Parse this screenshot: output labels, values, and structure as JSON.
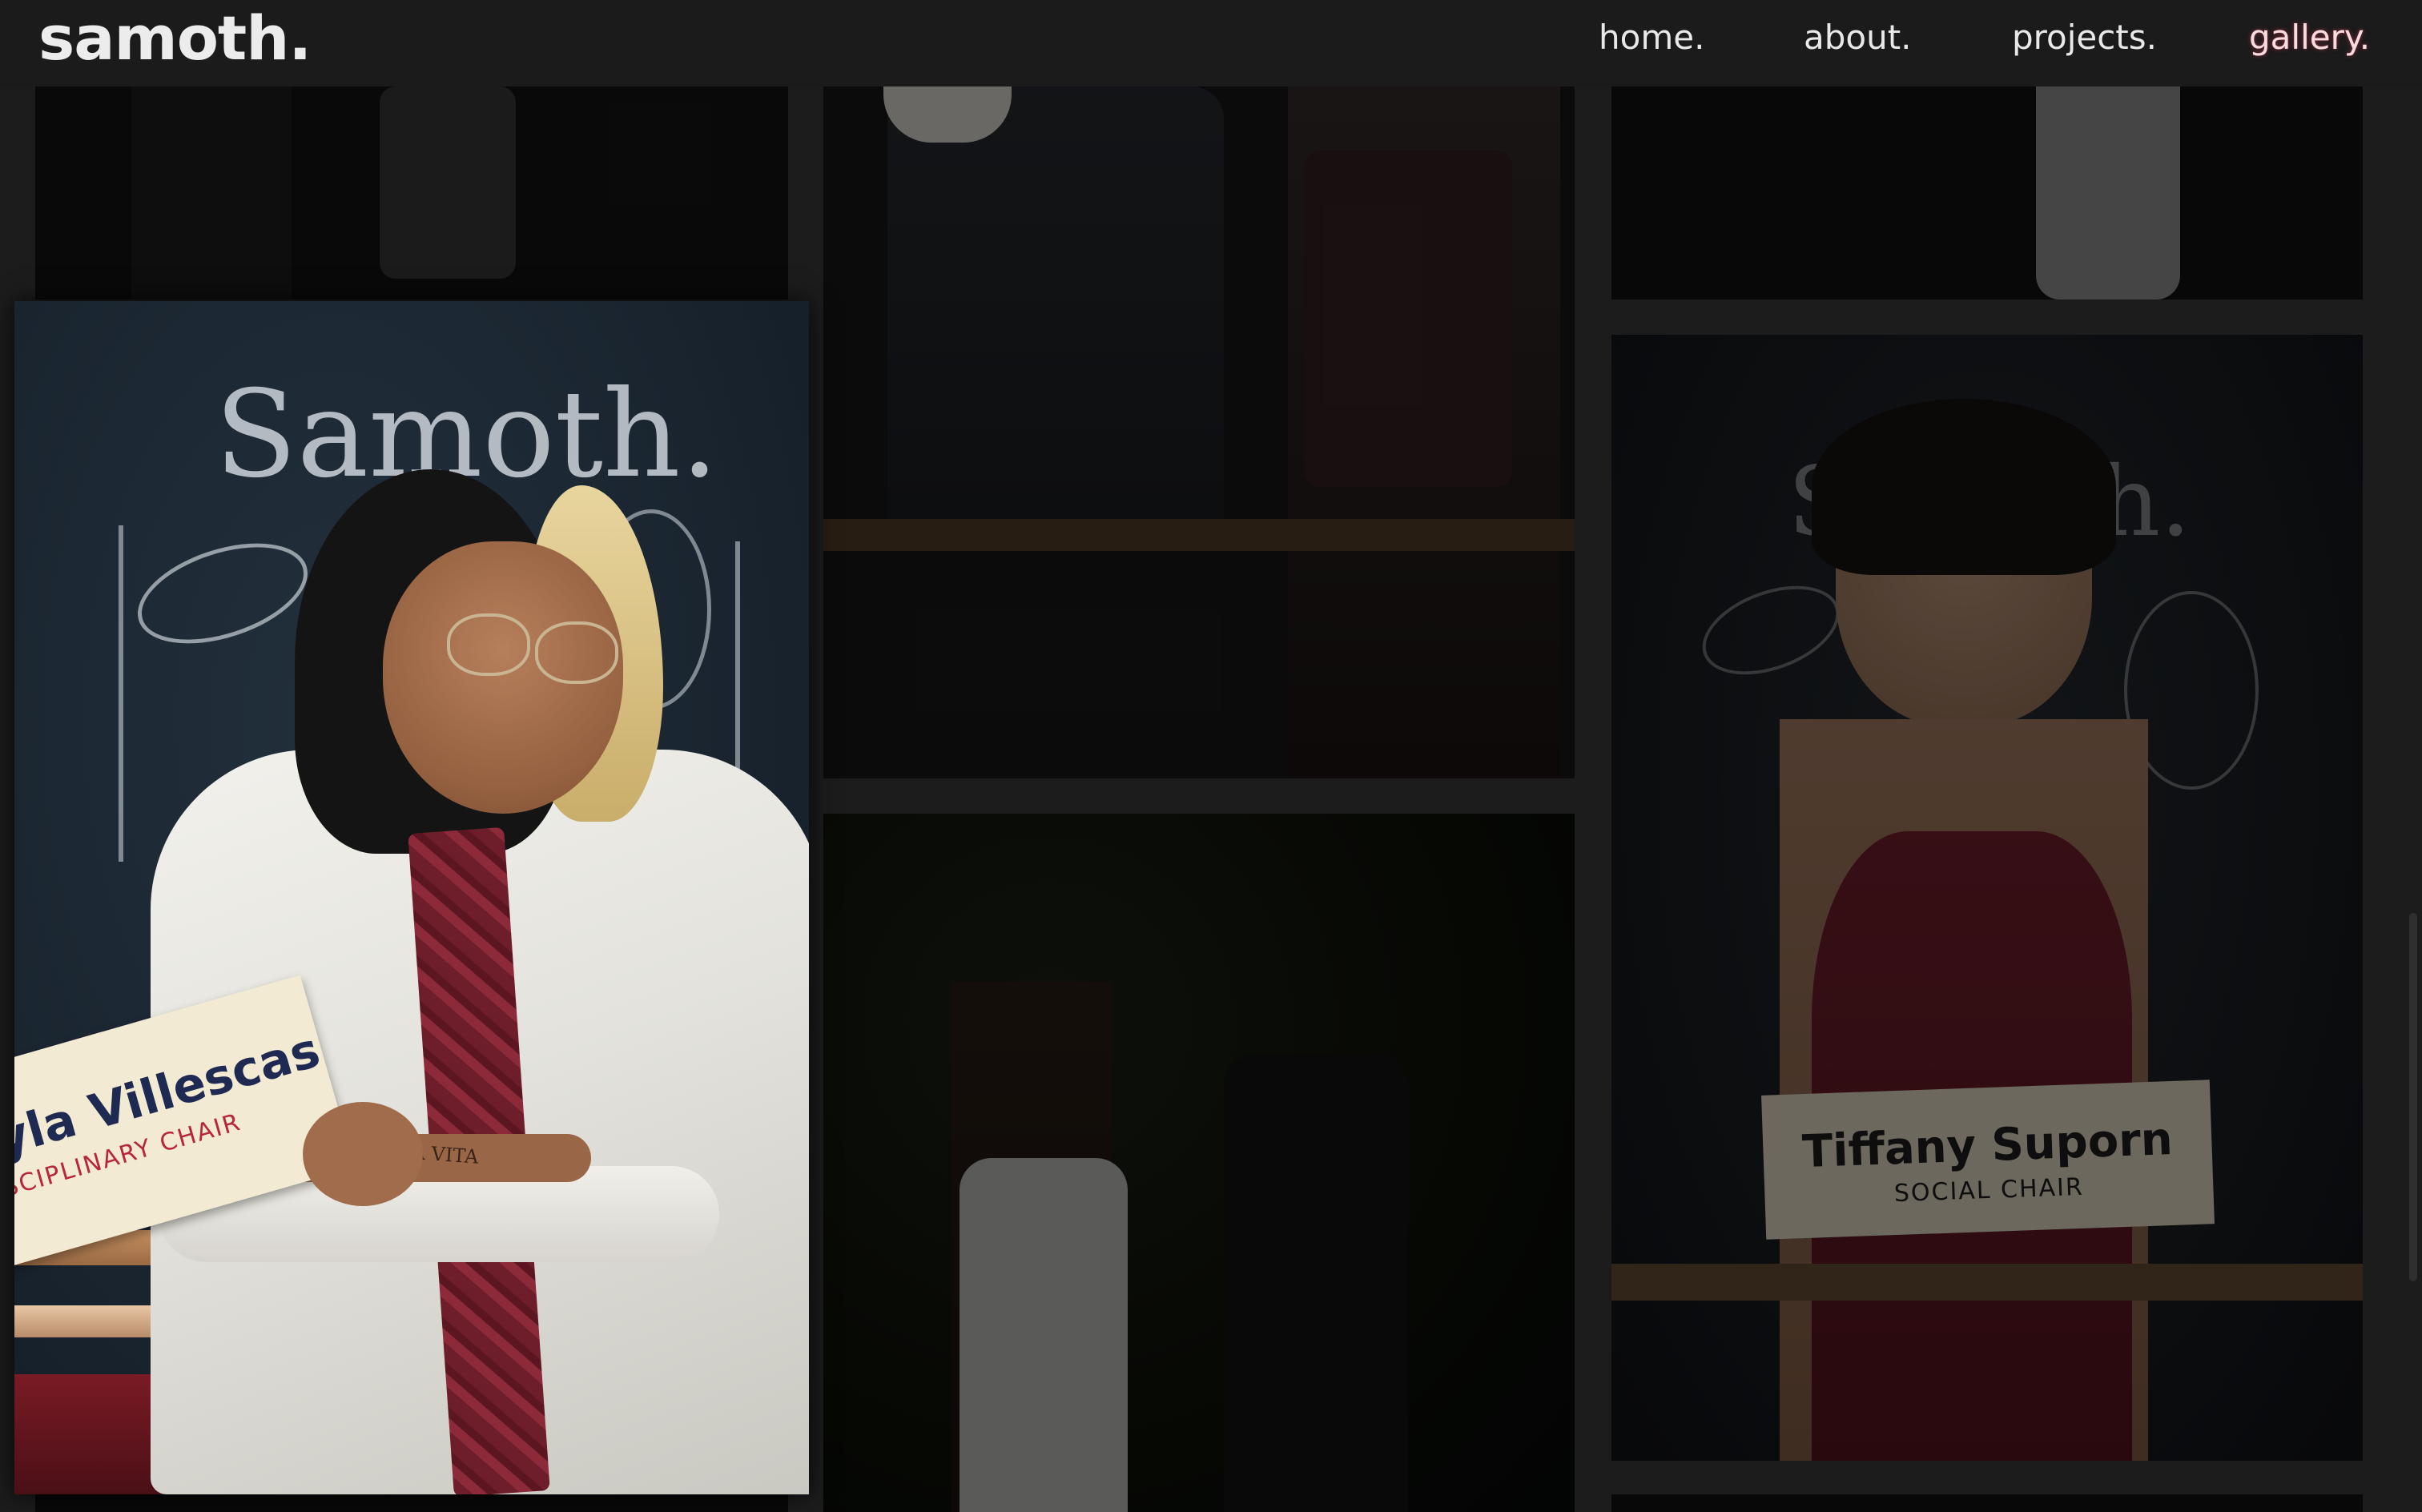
{
  "header": {
    "logo": "samoth.",
    "nav": [
      {
        "label": "home."
      },
      {
        "label": "about."
      },
      {
        "label": "projects."
      },
      {
        "label": "gallery.",
        "active": true
      }
    ]
  },
  "gallery": {
    "photo_1": {
      "chalk_text": "Samoth.",
      "sign_name": "yla Villescas",
      "sign_role": "SCIPLINARY CHAIR",
      "tattoo_text": "IL BALLO DELLA VITA"
    },
    "photo_2": {
      "chalk_text": "Samoth.",
      "sign_name": "Tiffany Suporn",
      "sign_role": "SOCIAL CHAIR"
    }
  },
  "colors": {
    "background": "#1c1c1c",
    "header": "#1b1b1b",
    "active_glow": "#c03050"
  }
}
